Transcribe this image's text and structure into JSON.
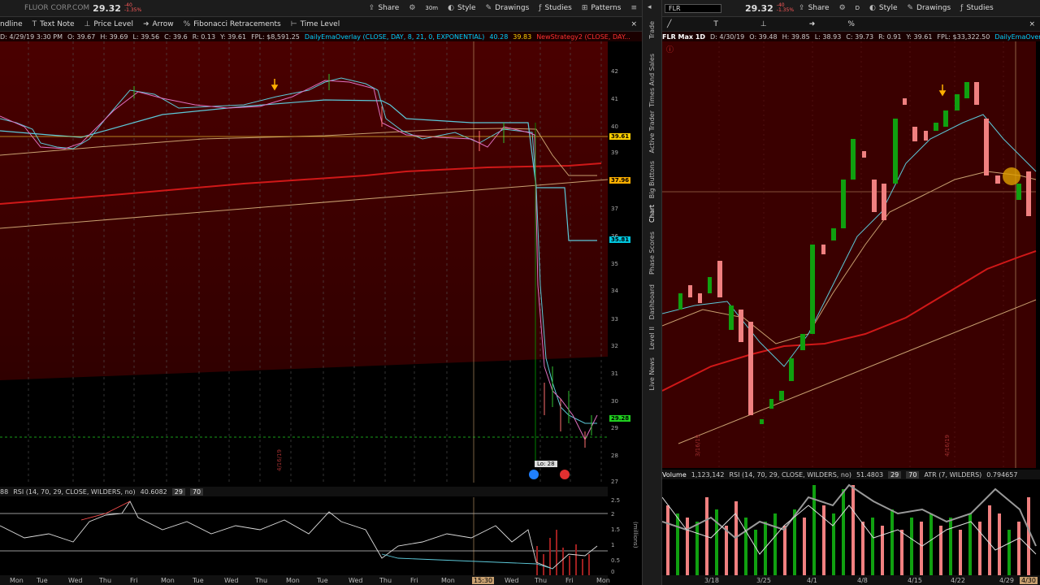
{
  "left": {
    "symbol": "FLUOR CORP.COM",
    "price": "29.32",
    "change": "-40",
    "change_pct": "-1.35%",
    "toolbar": {
      "share": "Share",
      "timeframe": "30m",
      "style": "Style",
      "drawings": "Drawings",
      "studies": "Studies",
      "patterns": "Patterns"
    },
    "draw_tools": [
      "ndline",
      "Text Note",
      "Price Level",
      "Arrow",
      "Fibonacci Retracements",
      "Time Level"
    ],
    "info": {
      "date": "D: 4/29/19 3:30 PM",
      "o": "O: 39.67",
      "h": "H: 39.69",
      "l": "L: 39.56",
      "c": "C: 39.6",
      "r": "R: 0.13",
      "y": "Y: 39.61",
      "fpl": "FPL: $8,591.25",
      "study": "DailyEmaOverlay (CLOSE, DAY, 8, 21, 0, EXPONENTIAL)",
      "v1": "40.28",
      "v2": "39.83",
      "study2": "NewStrategy2 (CLOSE, DAY..."
    },
    "y_labels": [
      "42",
      "41",
      "40",
      "39",
      "38",
      "37",
      "36",
      "35",
      "34",
      "33",
      "32",
      "31",
      "30",
      "29",
      "28",
      "27"
    ],
    "badges": [
      {
        "text": "39.61",
        "color": "#ffd000"
      },
      {
        "text": "37.96",
        "color": "#ffb000"
      },
      {
        "text": "35.81",
        "color": "#00c8e0"
      },
      {
        "text": "29.28",
        "color": "#20d020"
      }
    ],
    "low_label": "Lo: 28",
    "date_marker": "4/16/19",
    "rsi": {
      "label": "RSI (14, 70, 29, CLOSE, WILDERS, no)",
      "value": "40.6082",
      "ob": "29",
      "os": "70",
      "prefix": "88"
    },
    "rsi_y": [
      "2.5",
      "2",
      "1.5",
      "1",
      "0.5",
      "0"
    ],
    "rsi_unit": "(millions)",
    "x_labels": [
      "Mon",
      "Tue",
      "Wed",
      "Thu",
      "Fri",
      "Mon",
      "Tue",
      "Wed",
      "Thu",
      "Mon",
      "Tue",
      "Wed",
      "Thu",
      "Fri",
      "Mon",
      "15:30",
      "Wed",
      "Thu",
      "Fri",
      "Mon"
    ]
  },
  "side_tabs": [
    "Trade",
    "Times And Sales",
    "Active Trader",
    "Big Buttons",
    "Chart",
    "Phase Scores",
    "Dashboard",
    "Level II",
    "Live News"
  ],
  "right": {
    "symbol": "FLR",
    "price": "29.32",
    "change": "-40",
    "change_pct": "-1.35%",
    "toolbar": {
      "share": "Share",
      "style": "Style",
      "drawings": "Drawings",
      "studies": "Studies",
      "timeframe": "D"
    },
    "info": {
      "title": "FLR Max 1D",
      "date": "D: 4/30/19",
      "o": "O: 39.48",
      "h": "H: 39.85",
      "l": "L: 38.93",
      "c": "C: 39.73",
      "r": "R: 0.91",
      "y": "Y: 39.61",
      "fpl": "FPL: $33,322.50",
      "study": "DailyEmaOverlay"
    },
    "date_marker_1": "3/16/19",
    "date_marker_2": "4/16/19",
    "ind": {
      "vol_label": "Volume",
      "vol_value": "1,123,142",
      "rsi": "RSI (14, 70, 29, CLOSE, WILDERS, no)",
      "rsi_val": "51.4803",
      "ob": "29",
      "os": "70",
      "atr": "ATR (7, WILDERS)",
      "atr_val": "0.794657"
    },
    "x_labels": [
      "3/18",
      "3/25",
      "4/1",
      "4/8",
      "4/15",
      "4/22",
      "4/29"
    ],
    "last_x": "4/30"
  },
  "colors": {
    "bg_red": "#3a0000",
    "cyan": "#5cc8d8",
    "tan": "#c8a070",
    "red": "#d01818",
    "green": "#10a010",
    "pink": "#f08080"
  }
}
